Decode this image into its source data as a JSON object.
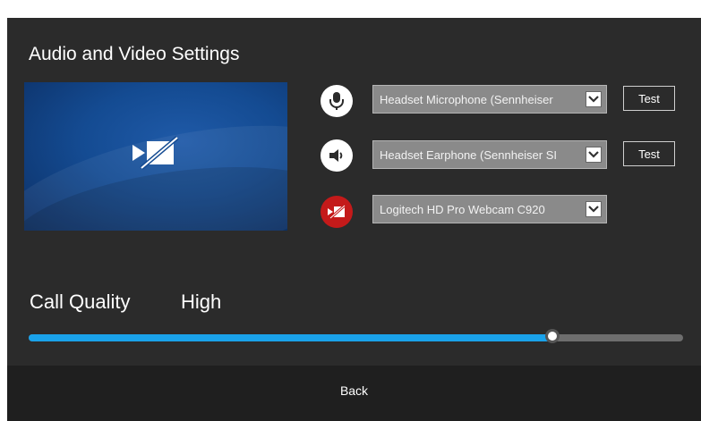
{
  "title": "Audio and Video Settings",
  "devices": [
    {
      "icon": "microphone-icon",
      "value": "Headset Microphone (Sennheiser",
      "test_label": "Test"
    },
    {
      "icon": "speaker-icon",
      "value": "Headset Earphone (Sennheiser SI",
      "test_label": "Test"
    },
    {
      "icon": "camera-off-icon",
      "value": "Logitech HD Pro Webcam C920"
    }
  ],
  "call_quality": {
    "label": "Call Quality",
    "value": "High",
    "level": 0.8
  },
  "footer": {
    "back_label": "Back"
  },
  "colors": {
    "panel": "#2b2b2b",
    "accent": "#1aa2ea",
    "camera_off": "#c41a1a",
    "select_bg": "#8a8a8a"
  }
}
